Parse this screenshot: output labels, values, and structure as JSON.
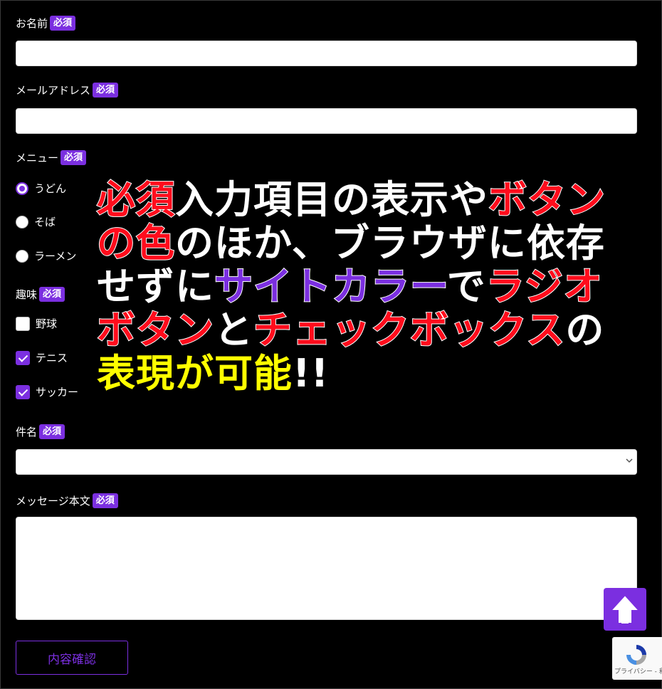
{
  "required_badge": "必須",
  "form": {
    "name": {
      "label": "お名前",
      "value": ""
    },
    "email": {
      "label": "メールアドレス",
      "value": ""
    },
    "menu": {
      "label": "メニュー",
      "options": [
        {
          "label": "うどん",
          "checked": true
        },
        {
          "label": "そば",
          "checked": false
        },
        {
          "label": "ラーメン",
          "checked": false
        }
      ]
    },
    "hobby": {
      "label": "趣味",
      "options": [
        {
          "label": "野球",
          "checked": false
        },
        {
          "label": "テニス",
          "checked": true
        },
        {
          "label": "サッカー",
          "checked": true
        }
      ]
    },
    "subject": {
      "label": "件名",
      "value": ""
    },
    "message": {
      "label": "メッセージ本文",
      "value": ""
    },
    "confirm_label": "内容確認"
  },
  "overlay": {
    "lines": [
      [
        {
          "text": "必須",
          "color": "red"
        },
        {
          "text": "入力項目の表示や",
          "color": "white"
        },
        {
          "text": "ボタン",
          "color": "red"
        }
      ],
      [
        {
          "text": "の色",
          "color": "red"
        },
        {
          "text": "のほか、ブラウザに依存",
          "color": "white"
        }
      ],
      [
        {
          "text": "せずに",
          "color": "white"
        },
        {
          "text": "サイトカラー",
          "color": "purple"
        },
        {
          "text": "で",
          "color": "white"
        },
        {
          "text": "ラジオ",
          "color": "red"
        }
      ],
      [
        {
          "text": "ボタン",
          "color": "red"
        },
        {
          "text": "と",
          "color": "white"
        },
        {
          "text": "チェックボックス",
          "color": "red"
        },
        {
          "text": "の",
          "color": "white"
        }
      ],
      [
        {
          "text": "表現が可能",
          "color": "yellow"
        },
        {
          "text": "!!",
          "color": "white"
        }
      ]
    ]
  },
  "recaptcha": {
    "text": "プライバシー - 利用規約"
  },
  "colors": {
    "accent": "#7b2fe0",
    "highlight_red": "#ff0c1c",
    "highlight_yellow": "#ffff00",
    "background": "#000000"
  },
  "icons": {
    "scroll_top": "arrow-up-icon",
    "recaptcha": "recaptcha-logo-icon",
    "select": "chevron-down-icon"
  }
}
